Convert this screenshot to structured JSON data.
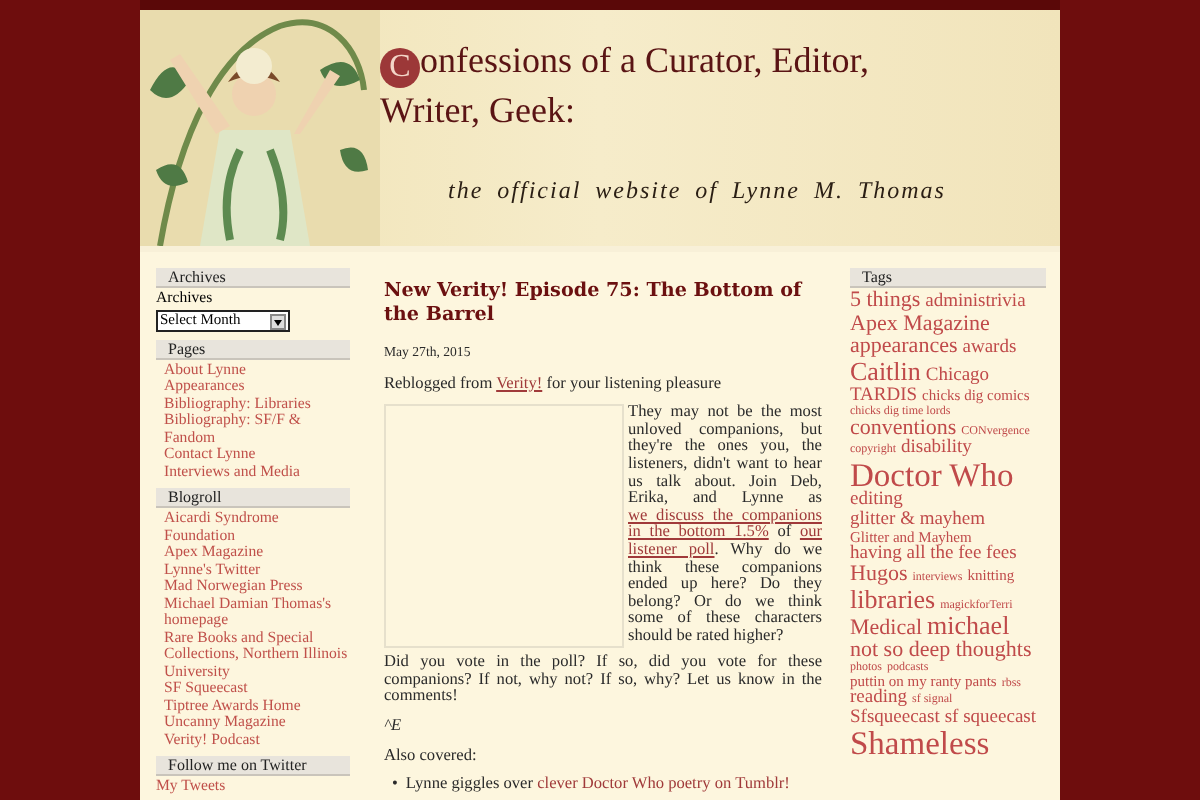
{
  "header": {
    "title_initial": "C",
    "title_rest": "onfessions of a Curator, Editor, Writer, Geek:",
    "tagline": "the official website of Lynne M. Thomas"
  },
  "left_sidebar": [
    {
      "kind": "archives",
      "heading": "Archives",
      "label": "Archives",
      "select": "Select Month"
    },
    {
      "kind": "links",
      "heading": "Pages",
      "links": [
        "About Lynne",
        "Appearances",
        "Bibliography: Libraries",
        "Bibliography: SF/F & Fandom",
        "Contact Lynne",
        "Interviews and Media"
      ]
    },
    {
      "kind": "links",
      "heading": "Blogroll",
      "links": [
        "Aicardi Syndrome Foundation",
        "Apex Magazine",
        "Lynne's Twitter",
        "Mad Norwegian Press",
        "Michael Damian Thomas's homepage",
        "Rare Books and Special Collections, Northern Illinois University",
        "SF Squeecast",
        "Tiptree Awards Home",
        "Uncanny Magazine",
        "Verity! Podcast"
      ]
    },
    {
      "kind": "twitter",
      "heading": "Follow me on Twitter",
      "link": "My Tweets"
    }
  ],
  "post": {
    "title": "New Verity! Episode 75: The Bottom of the Barrel",
    "date": "May 27th, 2015",
    "intro": [
      {
        "text": "Reblogged from "
      },
      {
        "text": "Verity!",
        "link": true
      },
      {
        "text": " for your listening pleasure"
      }
    ],
    "float_text": [
      {
        "text": "They may not be the most unloved companions, but they're the ones you, the listeners, didn't want to hear us talk about. Join Deb, Erika, and Lynne as "
      },
      {
        "text": "we discuss the companions",
        "link": true
      },
      {
        "text": "in the bottom 1.5%",
        "link": true
      },
      {
        "text": " of "
      },
      {
        "text": "our",
        "link": true
      },
      {
        "text": "listener poll",
        "link": true
      },
      {
        "text": ". Why do we think these companions ended up here? Do they belong? Or do we think some of these characters should be rated higher?"
      }
    ],
    "paragraphs": [
      "Did you vote in the poll? If so, did you vote for these companions? If not, why not? If so, why? Let us know in the comments!"
    ],
    "signature": "^E",
    "also": "Also covered:",
    "bullets": [
      {
        "marker": "•",
        "segments": [
          {
            "text": "Lynne giggles over "
          },
          {
            "text": "clever Doctor Who poetry on Tumblr!",
            "link": true
          }
        ]
      }
    ]
  },
  "tags": {
    "heading": "Tags",
    "items": [
      {
        "label": "5 things",
        "kind": "large"
      },
      {
        "label": "administrivia",
        "kind": "medium"
      },
      {
        "label": "Apex Magazine",
        "kind": "large"
      },
      {
        "label": "appearances",
        "kind": "large"
      },
      {
        "label": "awards",
        "kind": "medium"
      },
      {
        "label": "Caitlin",
        "kind": "xlarge"
      },
      {
        "label": "Chicago",
        "kind": "medium"
      },
      {
        "label": "TARDIS",
        "kind": "medium"
      },
      {
        "label": "chicks dig comics",
        "kind": "small"
      },
      {
        "label": "chicks dig time lords",
        "kind": "tiny"
      },
      {
        "label": "conventions",
        "kind": "large"
      },
      {
        "label": "CONvergence",
        "kind": "tiny"
      },
      {
        "label": "copyright",
        "kind": "tiny"
      },
      {
        "label": "disability",
        "kind": "medium"
      },
      {
        "label": "Doctor Who",
        "kind": "huge"
      },
      {
        "label": "editing",
        "kind": "medium"
      },
      {
        "label": "glitter & mayhem",
        "kind": "medium"
      },
      {
        "label": "Glitter and Mayhem",
        "kind": "small"
      },
      {
        "label": "having all the fee fees",
        "kind": "medium"
      },
      {
        "label": "Hugos",
        "kind": "large"
      },
      {
        "label": "interviews",
        "kind": "tiny"
      },
      {
        "label": "knitting",
        "kind": "small"
      },
      {
        "label": "libraries",
        "kind": "xlarge"
      },
      {
        "label": "magickforTerri",
        "kind": "tiny"
      },
      {
        "label": "Medical",
        "kind": "large"
      },
      {
        "label": "michael",
        "kind": "xlarge"
      },
      {
        "label": "not so deep thoughts",
        "kind": "large"
      },
      {
        "label": "photos",
        "kind": "tiny"
      },
      {
        "label": "podcasts",
        "kind": "tiny"
      },
      {
        "label": "puttin on my ranty pants",
        "kind": "small"
      },
      {
        "label": "rbss",
        "kind": "tiny"
      },
      {
        "label": "reading",
        "kind": "medium"
      },
      {
        "label": "sf signal",
        "kind": "tiny"
      },
      {
        "label": "Sfsqueecast",
        "kind": "medium"
      },
      {
        "label": "sf squeecast",
        "kind": "medium"
      },
      {
        "label": "Shameless",
        "kind": "huge"
      }
    ]
  }
}
